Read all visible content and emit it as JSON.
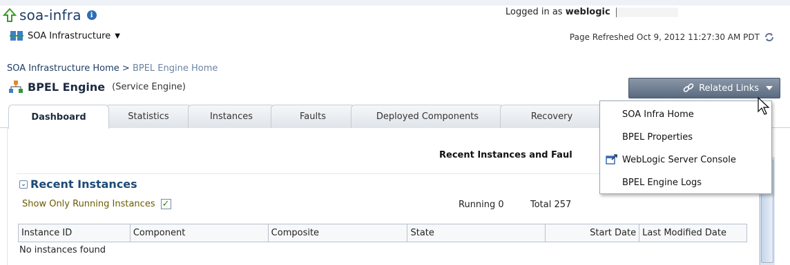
{
  "header": {
    "app_title": "soa-infra",
    "target_menu_label": "SOA Infrastructure",
    "logged_in_prefix": "Logged in as",
    "user": "weblogic",
    "page_refreshed": "Page Refreshed Oct 9, 2012 11:27:30 AM PDT"
  },
  "breadcrumb": {
    "home": "SOA Infrastructure Home",
    "separator": ">",
    "current": "BPEL Engine Home"
  },
  "page": {
    "title": "BPEL Engine",
    "subtitle": "(Service Engine)"
  },
  "related_links": {
    "label": "Related Links",
    "items": [
      "SOA Infra Home",
      "BPEL Properties",
      "WebLogic Server Console",
      "BPEL Engine Logs"
    ]
  },
  "tabs": [
    "Dashboard",
    "Statistics",
    "Instances",
    "Faults",
    "Deployed Components",
    "Recovery"
  ],
  "section_heading": "Recent Instances and Faul",
  "recent_instances": {
    "title": "Recent Instances",
    "filter_label": "Show Only Running Instances",
    "filter_checked": true,
    "running_label": "Running 0",
    "total_label": "Total 257",
    "columns": [
      "Instance ID",
      "Component",
      "Composite",
      "State",
      "Start Date",
      "Last Modified Date"
    ],
    "empty_message": "No instances found"
  },
  "colors": {
    "accent": "#1e3d66",
    "related_button": "#5a6a80",
    "filter_text": "#6b5a00"
  }
}
